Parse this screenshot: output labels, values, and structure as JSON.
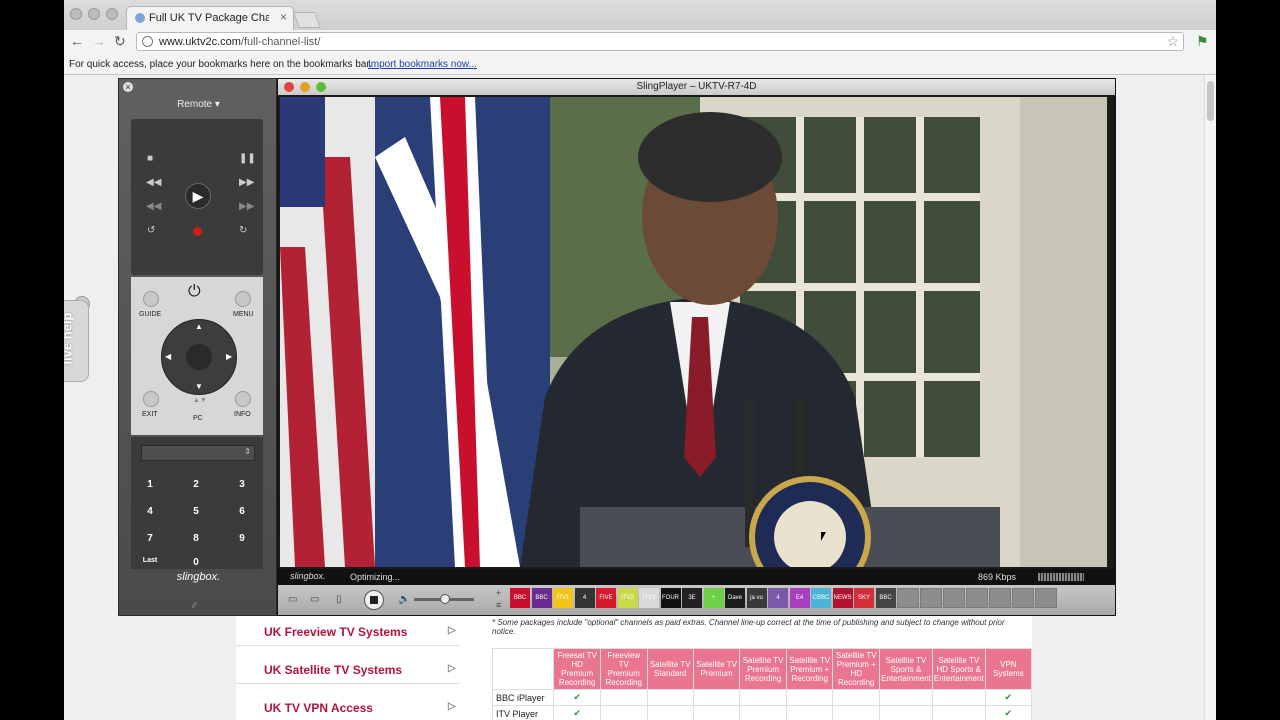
{
  "browser": {
    "tab_title": "Full UK TV Package Channel",
    "tab_close": "×",
    "url_host": "www.uktv2c.com",
    "url_path": "/full-channel-list/",
    "bookmarks_hint": "For quick access, place your bookmarks here on the bookmarks bar.",
    "import_link": "Import bookmarks now..."
  },
  "page": {
    "live_help": "live help",
    "menu": [
      "UK Freeview TV Systems",
      "UK Satellite TV Systems",
      "UK TV VPN Access"
    ],
    "note": "* Some packages include \"optional\" channels as paid extras. Channel line-up correct at the time of publishing and subject to change without prior notice.",
    "table": {
      "headers": [
        "Freesat TV HD Premium Recording",
        "Freeview TV Premium Recording",
        "Satellite TV Standard",
        "Satellite TV Premium",
        "Satellite TV Premium Recording",
        "Satellite TV Premium + Recording",
        "Satellite TV Premium + HD Recording",
        "Satellite TV Sports & Entertainment",
        "Satellite TV HD Sports & Entertainment",
        "VPN Systems"
      ],
      "rows": [
        {
          "label": "BBC iPlayer",
          "checks": [
            "✔",
            "",
            "",
            "",
            "",
            "",
            "",
            "",
            "",
            "✔"
          ]
        },
        {
          "label": "ITV Player",
          "checks": [
            "✔",
            "",
            "",
            "",
            "",
            "",
            "",
            "",
            "",
            "✔"
          ]
        }
      ]
    }
  },
  "remote": {
    "title": "Remote ▾",
    "close": "×",
    "labels": {
      "guide": "GUIDE",
      "menu": "MENU",
      "exit": "EXIT",
      "info": "INFO",
      "pc": "PC"
    },
    "numbers": [
      "1",
      "2",
      "3",
      "4",
      "5",
      "6",
      "7",
      "8",
      "9",
      "Last",
      "0"
    ],
    "logo": "slingbox."
  },
  "player": {
    "title": "SlingPlayer – UKTV-R7-4D",
    "logo": "slingbox.",
    "status": "Optimizing...",
    "bitrate": "869 Kbps",
    "channels": [
      {
        "name": "BBC ONE",
        "color": "#c8102e"
      },
      {
        "name": "BBC TWO",
        "color": "#6a2c91"
      },
      {
        "name": "ITV1",
        "color": "#f0c419"
      },
      {
        "name": "4",
        "color": "#333333"
      },
      {
        "name": "FIVE",
        "color": "#d7192e"
      },
      {
        "name": "ITV2",
        "color": "#c9d94a"
      },
      {
        "name": "ITV3",
        "color": "#d9d9d9"
      },
      {
        "name": "FOUR",
        "color": "#111111"
      },
      {
        "name": "3E",
        "color": "#222222"
      },
      {
        "name": "+",
        "color": "#6fcf4a"
      },
      {
        "name": "Dave",
        "color": "#1c1c1c"
      },
      {
        "name": "ja vu",
        "color": "#3a3a3a"
      },
      {
        "name": "4",
        "color": "#7a5aa8"
      },
      {
        "name": "E4",
        "color": "#a83fbf"
      },
      {
        "name": "CBBC",
        "color": "#4ab3d6"
      },
      {
        "name": "NEWS",
        "color": "#b0142c"
      },
      {
        "name": "SKY NEWS",
        "color": "#d12f3a"
      },
      {
        "name": "BBC",
        "color": "#444444"
      }
    ],
    "empty_slots": 7
  }
}
